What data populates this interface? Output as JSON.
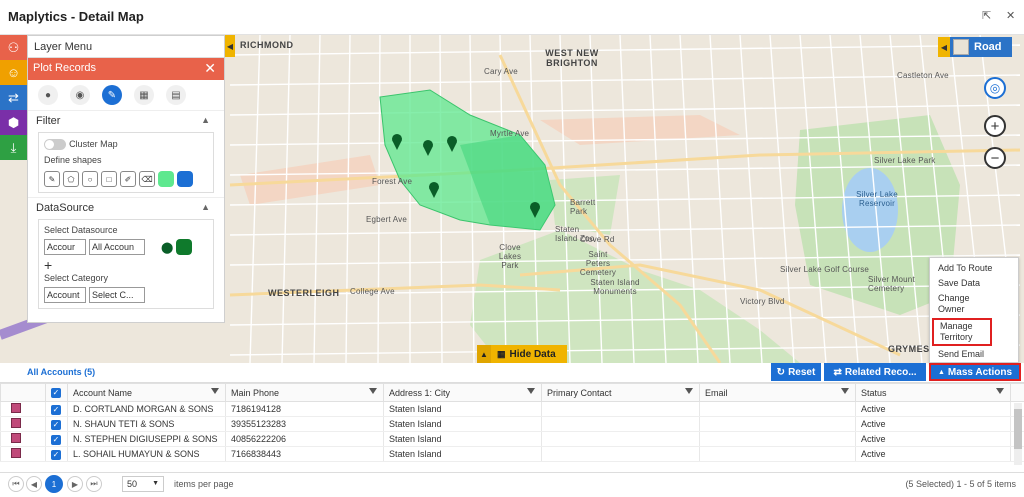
{
  "window": {
    "title": "Maplytics - Detail Map"
  },
  "layer_menu": {
    "title": "Layer Menu",
    "plot_records": "Plot Records",
    "filter": "Filter",
    "cluster_map": "Cluster Map",
    "define_shapes": "Define shapes",
    "datasource": "DataSource",
    "select_datasource": "Select Datasource",
    "datasource_entity": "Accour",
    "datasource_view": "All Accoun",
    "select_category": "Select Category",
    "category_entity": "Account",
    "category_field": "Select C..."
  },
  "map": {
    "road_label": "Road",
    "hide_data": "Hide Data",
    "labels": {
      "richmond": "RICHMOND",
      "west_new_brighton": "WEST NEW BRIGHTON",
      "westerleigh": "WESTERLEIGH",
      "silver_lake_park": "Silver Lake Park",
      "silver_lake_reservoir": "Silver Lake Reservoir",
      "silver_lake_golf": "Silver Lake Golf Course",
      "barrett_park": "Barrett Park",
      "staten_island_zoo": "Staten Island Zoo",
      "clove_lakes_park": "Clove Lakes Park",
      "saint_peters": "Saint Peters Cemetery",
      "staten_island_monuments": "Staten Island Monuments",
      "silver_mount": "Silver Mount Cemetery",
      "grymes": "GRYMES H",
      "forest_ave": "Forest Ave",
      "castleton_ave": "Castleton Ave",
      "victory_blvd": "Victory Blvd",
      "clove_rd": "Clove Rd",
      "college_ave": "College Ave",
      "egbert_ave": "Egbert Ave",
      "myrtle_ave": "Myrtle Ave",
      "cary_ave": "Cary Ave"
    }
  },
  "mass_actions_menu": {
    "items": [
      "Add To Route",
      "Save Data",
      "Change Owner",
      "Manage Territory",
      "Send Email"
    ]
  },
  "grid": {
    "tab_label": "All Accounts (5)",
    "reset": "Reset",
    "related": "Related Reco...",
    "mass_actions": "Mass Actions",
    "columns": [
      "Account Name",
      "Main Phone",
      "Address 1: City",
      "Primary Contact",
      "Email",
      "Status"
    ],
    "rows": [
      {
        "name": "D. CORTLAND MORGAN & SONS",
        "phone": "7186194128",
        "city": "Staten Island",
        "contact": "",
        "email": "",
        "status": "Active"
      },
      {
        "name": "N. SHAUN TETI & SONS",
        "phone": "39355123283",
        "city": "Staten Island",
        "contact": "",
        "email": "",
        "status": "Active"
      },
      {
        "name": "N. STEPHEN DIGIUSEPPI & SONS",
        "phone": "40856222206",
        "city": "Staten Island",
        "contact": "",
        "email": "",
        "status": "Active"
      },
      {
        "name": "L. SOHAIL HUMAYUN & SONS",
        "phone": "7166838443",
        "city": "Staten Island",
        "contact": "",
        "email": "",
        "status": "Active"
      }
    ]
  },
  "pager": {
    "current": "1",
    "page_size": "50",
    "items_per_page": "items per page",
    "summary": "(5 Selected) 1 - 5 of 5 items"
  },
  "colors": {
    "accent": "#1c6fd4",
    "plot_header": "#e8624a",
    "territory": "#5ee88f",
    "highlight": "#e02020",
    "yellow": "#f0b400"
  }
}
